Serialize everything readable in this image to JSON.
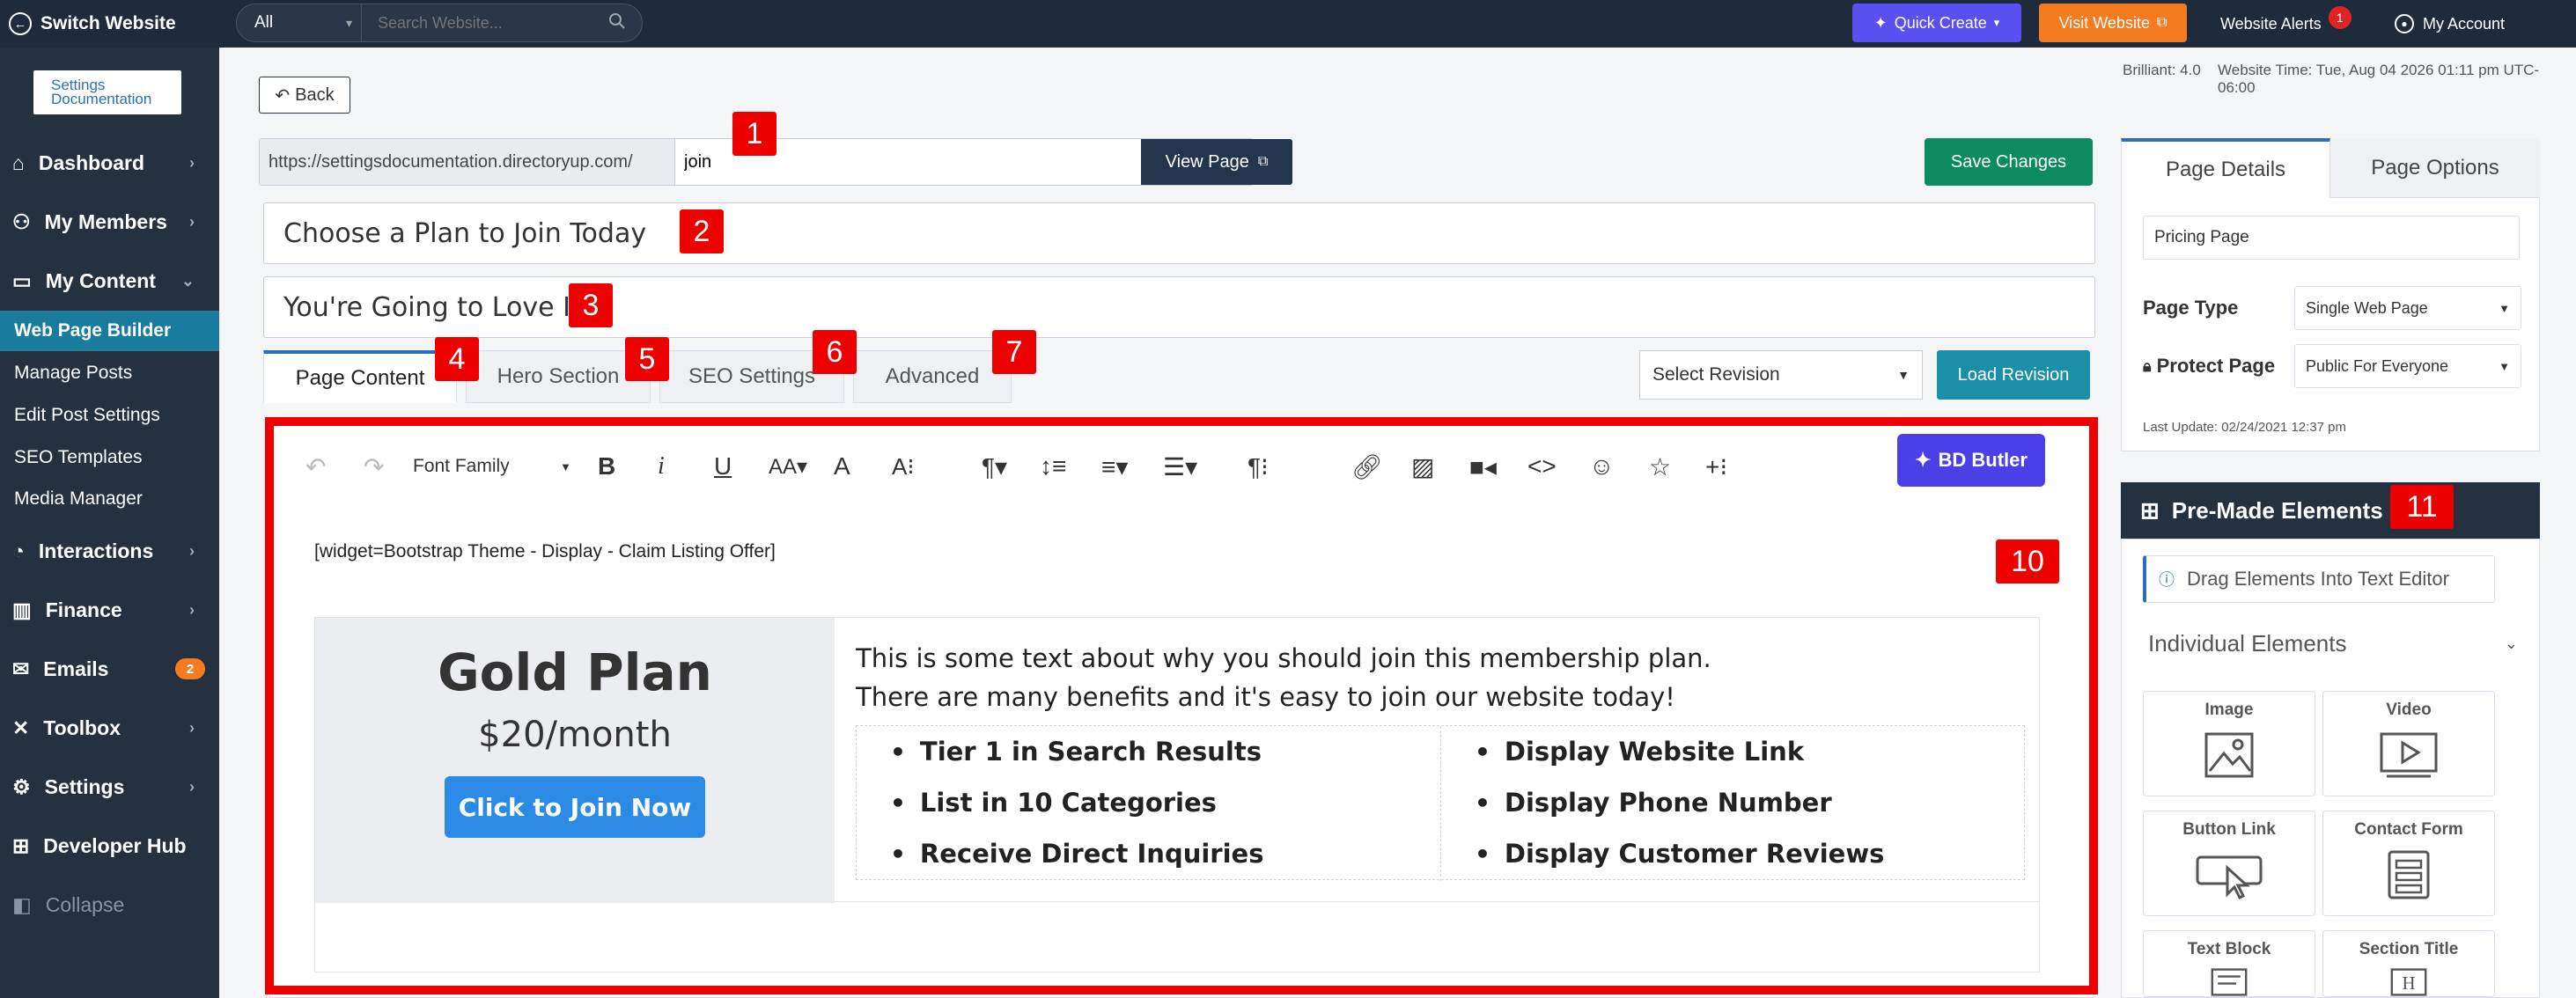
{
  "topbar": {
    "switch_label": "Switch Website",
    "search_scope": "All",
    "search_placeholder": "Search Website...",
    "quick_create": "Quick Create",
    "visit_website": "Visit Website",
    "alerts_label": "Website Alerts",
    "alerts_count": "1",
    "account_label": "My Account"
  },
  "sidebar": {
    "logo_line1": "Settings",
    "logo_line2": "Documentation",
    "items": [
      {
        "label": "Dashboard"
      },
      {
        "label": "My Members"
      },
      {
        "label": "My Content"
      },
      {
        "label": "Interactions"
      },
      {
        "label": "Finance"
      },
      {
        "label": "Emails",
        "badge": "2"
      },
      {
        "label": "Toolbox"
      },
      {
        "label": "Settings"
      },
      {
        "label": "Developer Hub"
      },
      {
        "label": "Collapse"
      }
    ],
    "sub_items": [
      {
        "label": "Web Page Builder"
      },
      {
        "label": "Manage Posts"
      },
      {
        "label": "Edit Post Settings"
      },
      {
        "label": "SEO Templates"
      },
      {
        "label": "Media Manager"
      }
    ]
  },
  "header": {
    "back": "Back",
    "version": "Brilliant: 4.0",
    "website_time": "Website Time: Tue, Aug 04 2026 01:11 pm UTC-06:00"
  },
  "page": {
    "url_prefix": "https://settingsdocumentation.directoryup.com/",
    "url_slug": "join",
    "view_page": "View Page",
    "save_changes": "Save Changes",
    "title": "Choose a Plan to Join Today",
    "subtitle": "You're Going to Love It!",
    "tabs": [
      "Page Content",
      "Hero Section",
      "SEO Settings",
      "Advanced"
    ],
    "revision_select": "Select Revision",
    "load_revision": "Load Revision"
  },
  "editor": {
    "font_family": "Font Family",
    "butler": "BD Butler",
    "widget_text": "[widget=Bootstrap Theme - Display - Claim Listing Offer]",
    "plan_name": "Gold Plan",
    "plan_price": "$20/month",
    "plan_button": "Click to Join Now",
    "plan_line1": "This is some text about why you should join this membership plan.",
    "plan_line2": "There are many benefits and it's easy to join our website today!",
    "features_left": [
      "Tier 1 in Search Results",
      "List in 10 Categories",
      "Receive Direct Inquiries"
    ],
    "features_right": [
      "Display Website Link",
      "Display Phone Number",
      "Display Customer Reviews"
    ]
  },
  "right_panel": {
    "tab_details": "Page Details",
    "tab_options": "Page Options",
    "page_name": "Pricing Page",
    "page_type_label": "Page Type",
    "page_type_value": "Single Web Page",
    "protect_label": "Protect Page",
    "protect_value": "Public For Everyone",
    "last_update": "Last Update: 02/24/2021 12:37 pm",
    "premade_title": "Pre-Made Elements",
    "drag_hint": "Drag Elements Into Text Editor",
    "individual": "Individual Elements",
    "elements": [
      "Image",
      "Video",
      "Button Link",
      "Contact Form",
      "Text Block",
      "Section Title"
    ]
  },
  "callouts": [
    "1",
    "2",
    "3",
    "4",
    "5",
    "6",
    "7",
    "10",
    "11"
  ]
}
